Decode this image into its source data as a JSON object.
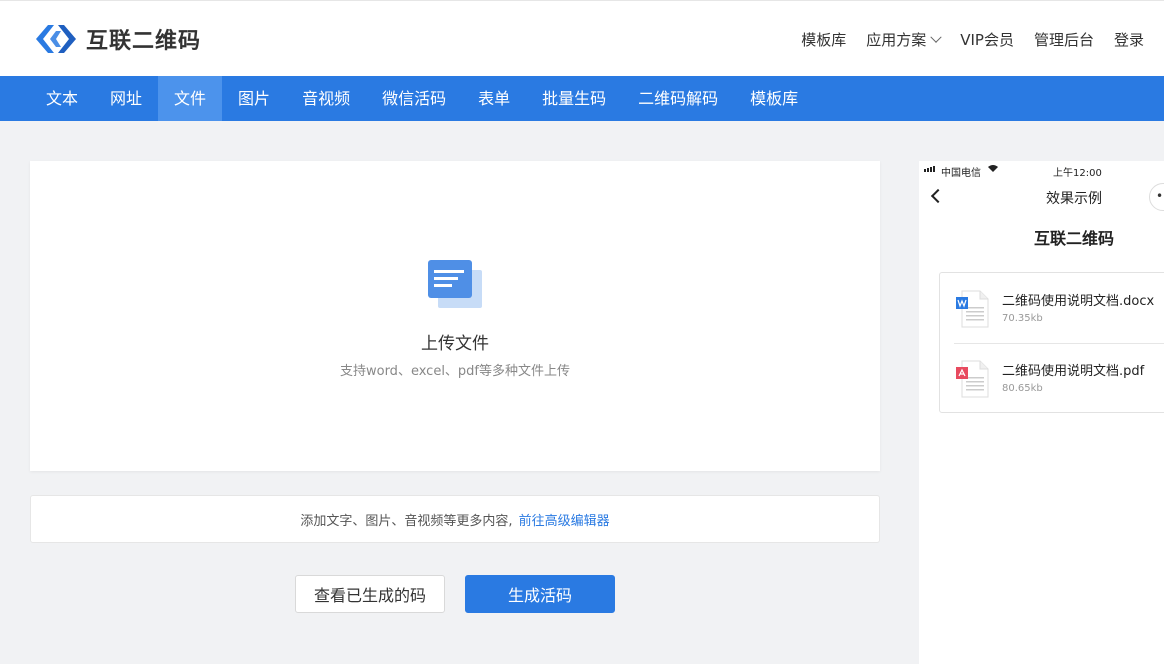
{
  "header": {
    "brand": "互联二维码",
    "links": [
      "模板库",
      "应用方案",
      "VIP会员",
      "管理后台",
      "登录"
    ]
  },
  "nav": {
    "items": [
      "文本",
      "网址",
      "文件",
      "图片",
      "音视频",
      "微信活码",
      "表单",
      "批量生码",
      "二维码解码",
      "模板库"
    ],
    "active": "文件"
  },
  "upload": {
    "title": "上传文件",
    "hint": "支持word、excel、pdf等多种文件上传"
  },
  "editor": {
    "text": "添加文字、图片、音视频等更多内容,",
    "link": "前往高级编辑器"
  },
  "buttons": {
    "view": "查看已生成的码",
    "generate": "生成活码"
  },
  "preview": {
    "carrier": "中国电信",
    "time": "上午12:00",
    "title": "效果示例",
    "brand": "互联二维码",
    "files": [
      {
        "name": "二维码使用说明文档.docx",
        "size": "70.35kb",
        "type": "word"
      },
      {
        "name": "二维码使用说明文档.pdf",
        "size": "80.65kb",
        "type": "pdf"
      }
    ]
  },
  "colors": {
    "accent": "#2a7ae2",
    "nav_active": "#4c93ec",
    "word": "#2a7ae2",
    "pdf": "#e84a5f"
  }
}
